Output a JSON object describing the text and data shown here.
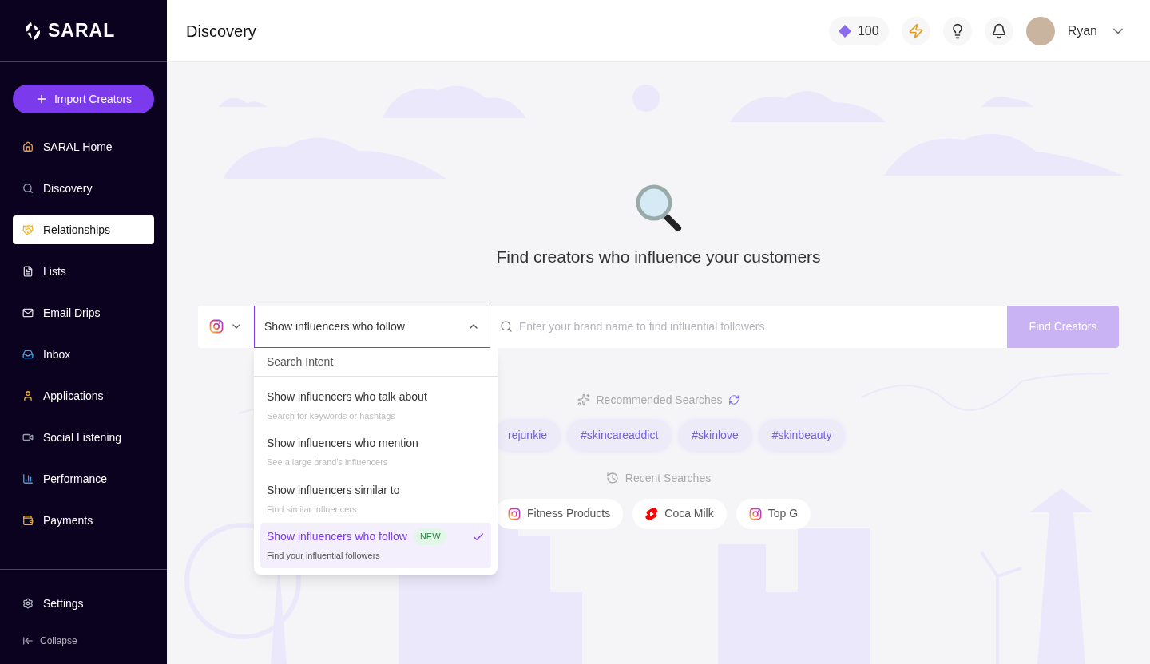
{
  "sidebar": {
    "logo": "SARAL",
    "import_button": "Import Creators",
    "items": [
      {
        "label": "SARAL Home",
        "kind": "home",
        "selected": false
      },
      {
        "label": "Discovery",
        "kind": "search",
        "selected": false
      },
      {
        "label": "Relationships",
        "kind": "handshake",
        "selected": true
      },
      {
        "label": "Lists",
        "kind": "file",
        "selected": false
      },
      {
        "label": "Email Drips",
        "kind": "mail",
        "selected": false
      },
      {
        "label": "Inbox",
        "kind": "inbox",
        "selected": false
      },
      {
        "label": "Applications",
        "kind": "user",
        "selected": false
      },
      {
        "label": "Social Listening",
        "kind": "video",
        "selected": false
      },
      {
        "label": "Performance",
        "kind": "chart",
        "selected": false
      },
      {
        "label": "Payments",
        "kind": "money",
        "selected": false
      }
    ],
    "footer_items": [
      {
        "label": "Settings",
        "kind": "settings"
      }
    ],
    "collapse": "Collapse"
  },
  "header": {
    "title": "Discovery",
    "credits": "100",
    "user": "Ryan"
  },
  "hero": {
    "title": "Find creators who influence your customers"
  },
  "search_bar": {
    "kind": "instagram",
    "intent": "Show influencers who follow",
    "expanded": true,
    "placeholder": "Enter your brand name to find influential followers",
    "button": "Find Creators"
  },
  "intent_menu": {
    "header": "Search Intent",
    "options": [
      {
        "label": "Show influencers who talk about",
        "hint": "Search for keywords or hashtags",
        "selected": false
      },
      {
        "label": "Show influencers who mention",
        "hint": "See a large brand's influencers",
        "selected": false
      },
      {
        "label": "Show influencers similar to",
        "hint": "Find similar influencers",
        "selected": false
      },
      {
        "label": "Show influencers who follow",
        "hint": "Find your influential followers",
        "selected": true,
        "badge": "NEW"
      }
    ]
  },
  "recommended": {
    "title": "Recommended Searches",
    "chips": [
      "rejunkie",
      "#skincareaddict",
      "#skinlove",
      "#skinbeauty"
    ]
  },
  "recent": {
    "title": "Recent Searches",
    "items": [
      {
        "label": "Fitness Products",
        "kind": "instagram"
      },
      {
        "label": "Coca Milk",
        "kind": "shorts"
      },
      {
        "label": "Top G",
        "kind": "instagram"
      }
    ]
  }
}
